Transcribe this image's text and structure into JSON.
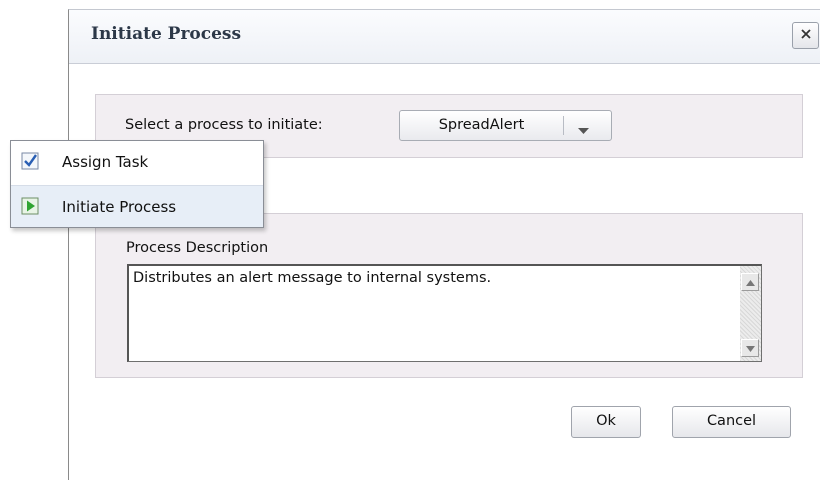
{
  "dialog": {
    "title": "Initiate Process",
    "close_label": "×"
  },
  "process_select": {
    "label": "Select a process to initiate:",
    "value": "SpreadAlert"
  },
  "description": {
    "label": "Process Description",
    "text": "Distributes an alert message to internal systems."
  },
  "buttons": {
    "ok": "Ok",
    "cancel": "Cancel"
  },
  "menu": {
    "items": [
      {
        "label": "Assign Task",
        "icon": "checkbox-icon"
      },
      {
        "label": "Initiate Process",
        "icon": "play-icon"
      }
    ]
  },
  "colors": {
    "title_text": "#2c3848",
    "panel_bg": "#f2eef2",
    "menu_selected_bg": "#e7eef7",
    "play_green": "#2fa431",
    "check_blue": "#2a5fb4"
  }
}
